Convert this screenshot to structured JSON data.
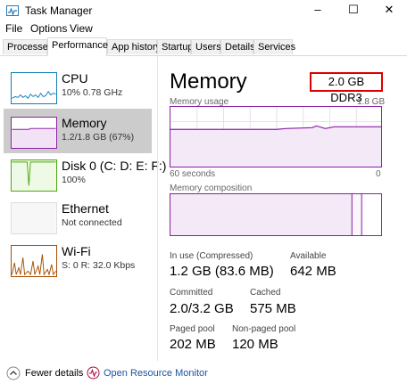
{
  "window": {
    "title": "Task Manager",
    "minimize": "–",
    "maximize": "☐",
    "close": "✕"
  },
  "menu": [
    "File",
    "Options",
    "View"
  ],
  "tabs": [
    "Processes",
    "Performance",
    "App history",
    "Startup",
    "Users",
    "Details",
    "Services"
  ],
  "sidebar": [
    {
      "title": "CPU",
      "sub": "10% 0.78 GHz",
      "color": "#117dbb"
    },
    {
      "title": "Memory",
      "sub": "1.2/1.8 GB (67%)",
      "color": "#8b1ea6"
    },
    {
      "title": "Disk 0 (C: D: E: F:)",
      "sub": "100%",
      "color": "#4da60c"
    },
    {
      "title": "Ethernet",
      "sub": "Not connected",
      "color": "#a74f01"
    },
    {
      "title": "Wi-Fi",
      "sub": "S: 0 R: 32.0 Kbps",
      "color": "#a74f01"
    }
  ],
  "main": {
    "title": "Memory",
    "type": "2.0 GB DDR3",
    "usage_label": "Memory usage",
    "usage_max": "1.8 GB",
    "time_left": "60 seconds",
    "time_right": "0",
    "composition_label": "Memory composition",
    "stats": {
      "in_use_label": "In use (Compressed)",
      "in_use_value": "1.2 GB (83.6 MB)",
      "available_label": "Available",
      "available_value": "642 MB",
      "committed_label": "Committed",
      "committed_value": "2.0/3.2 GB",
      "cached_label": "Cached",
      "cached_value": "575 MB",
      "paged_label": "Paged pool",
      "paged_value": "202 MB",
      "nonpaged_label": "Non-paged pool",
      "nonpaged_value": "120 MB"
    }
  },
  "footer": {
    "fewer_details": "Fewer details",
    "open_monitor": "Open Resource Monitor"
  },
  "colors": {
    "memory": "#8b1ea6",
    "link": "#1a55a3",
    "highlight_border": "#dd0000"
  }
}
